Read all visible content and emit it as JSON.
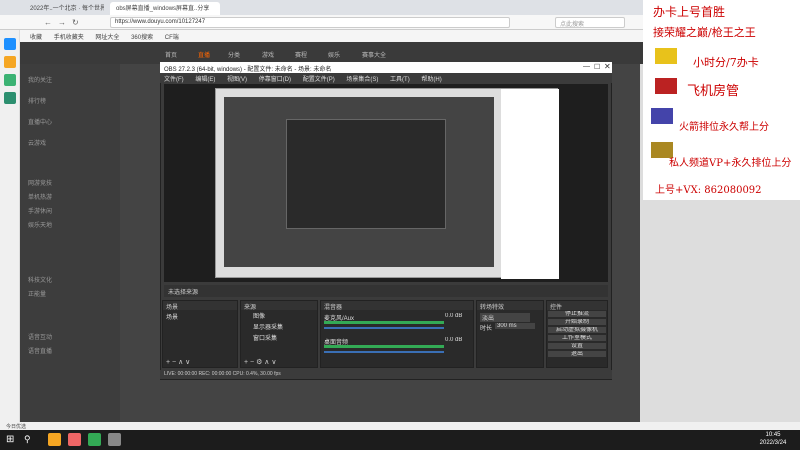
{
  "browser": {
    "tabs": [
      "2022年..一个北京 · 每个世界",
      "obs屏幕直播_windows屏幕直..分享"
    ],
    "url": "https://www.douyu.com/10127247",
    "search_placeholder": "点此搜索",
    "bookmarks": [
      "收藏",
      "手机收藏夹",
      "网址大全",
      "360搜索",
      "CF端"
    ]
  },
  "site": {
    "nav": [
      "首页",
      "直播",
      "分类",
      "游戏",
      "赛程",
      "娱乐",
      "赛事大全"
    ],
    "side_items": [
      "我的关注",
      "排行榜",
      "直播中心",
      "云游戏",
      "网游竞技",
      "单机热游",
      "手游休闲",
      "娱乐天地",
      "科技文化",
      "正能量",
      "语音互动",
      "语音直播"
    ]
  },
  "obs": {
    "title": "OBS 27.2.3 (64-bit, windows) - 配置文件: 未命名 - 场景: 未命名",
    "menu": [
      "文件(F)",
      "编辑(E)",
      "视图(V)",
      "停靠窗口(D)",
      "配置文件(P)",
      "场景集合(S)",
      "工具(T)",
      "帮助(H)"
    ],
    "docks": {
      "scenes": "场景",
      "sources": "来源",
      "mixer": "混音器",
      "transitions": "转场特效",
      "controls": "控件"
    },
    "scene_items": [
      "场景"
    ],
    "source_items": [
      "图像",
      "显示器采集",
      "窗口采集"
    ],
    "mixer_tracks": [
      {
        "name": "麦克风/Aux",
        "db": "0.0 dB",
        "level": 0.55
      },
      {
        "name": "桌面音频",
        "db": "0.0 dB",
        "level": 0.45
      }
    ],
    "transition": "淡出",
    "duration_label": "时长",
    "duration": "300 ms",
    "controls": [
      "停止推流",
      "开始录制",
      "启动虚拟摄像机",
      "工作室模式",
      "设置",
      "退出"
    ],
    "status": "LIVE: 00:00:00    REC: 00:00:00    CPU: 0.4%, 30.00 fps",
    "preview_label": "未选择来源"
  },
  "overlay": {
    "lines": [
      "办卡上号首胜",
      "接荣耀之巅/枪王之王",
      "小时分/7办卡",
      "飞机房管",
      "火箭排位永久帮上分",
      "私人频道VP+永久排位上分",
      "上号+VX: 862080092"
    ]
  },
  "taskbar": {
    "time": "10:45",
    "date": "2022/3/24"
  },
  "bottom_bar": "今日优选"
}
